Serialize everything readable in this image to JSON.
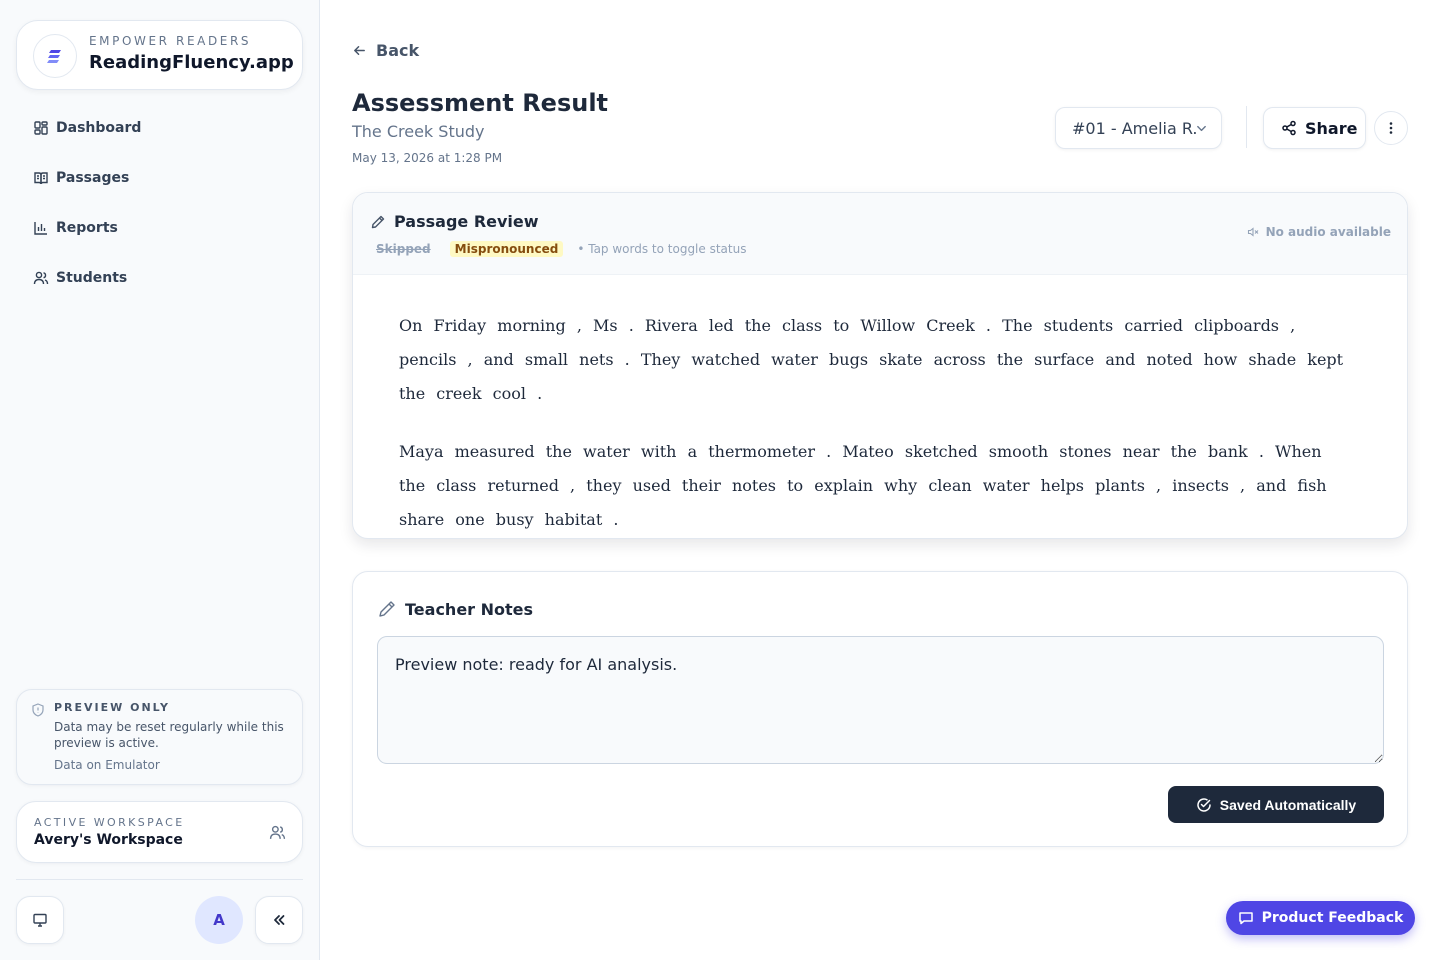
{
  "brand": {
    "kicker": "EMPOWER READERS",
    "name": "ReadingFluency.app",
    "accent": "#4f46e5"
  },
  "sidebar": {
    "items": [
      {
        "label": "Dashboard",
        "icon": "dashboard-icon"
      },
      {
        "label": "Passages",
        "icon": "book-open-icon"
      },
      {
        "label": "Reports",
        "icon": "bar-chart-icon"
      },
      {
        "label": "Students",
        "icon": "users-icon"
      }
    ],
    "preview": {
      "title": "PREVIEW ONLY",
      "text": "Data may be reset regularly while this preview is active.",
      "link": "Data on Emulator"
    },
    "workspace": {
      "kicker": "ACTIVE WORKSPACE",
      "name": "Avery's Workspace"
    },
    "avatar_initial": "A"
  },
  "header": {
    "back_label": "Back",
    "title": "Assessment Result",
    "subtitle": "The Creek Study",
    "date": "May 13, 2026 at 1:28 PM",
    "student_select": "#01 - Amelia R.",
    "share_label": "Share"
  },
  "passage": {
    "title": "Passage Review",
    "legend_skipped": "Skipped",
    "legend_mispronounced": "Mispronounced",
    "legend_hint": "• Tap words to toggle status",
    "audio_status": "No audio available",
    "paragraphs": [
      [
        "On",
        "Friday",
        "morning",
        ",",
        "Ms",
        ".",
        "Rivera",
        "led",
        "the",
        "class",
        "to",
        "Willow",
        "Creek",
        ".",
        "The",
        "students",
        "carried",
        "clipboards",
        ",",
        "pencils",
        ",",
        "and",
        "small",
        "nets",
        ".",
        "They",
        "watched",
        "water",
        "bugs",
        "skate",
        "across",
        "the",
        "surface",
        "and",
        "noted",
        "how",
        "shade",
        "kept",
        "the",
        "creek",
        "cool",
        "."
      ],
      [
        "Maya",
        "measured",
        "the",
        "water",
        "with",
        "a",
        "thermometer",
        ".",
        "Mateo",
        "sketched",
        "smooth",
        "stones",
        "near",
        "the",
        "bank",
        ".",
        "When",
        "the",
        "class",
        "returned",
        ",",
        "they",
        "used",
        "their",
        "notes",
        "to",
        "explain",
        "why",
        "clean",
        "water",
        "helps",
        "plants",
        ",",
        "insects",
        ",",
        "and",
        "fish",
        "share",
        "one",
        "busy",
        "habitat",
        "."
      ]
    ]
  },
  "notes": {
    "title": "Teacher Notes",
    "value": "Preview note: ready for AI analysis.",
    "saved_label": "Saved Automatically"
  },
  "feedback": {
    "label": "Product Feedback"
  },
  "colors": {
    "sidebar_bg": "#f8fafc",
    "dark_button": "#1e293b",
    "mispronounced_bg": "#fef9c3",
    "feedback_bg": "#4f46e5"
  }
}
